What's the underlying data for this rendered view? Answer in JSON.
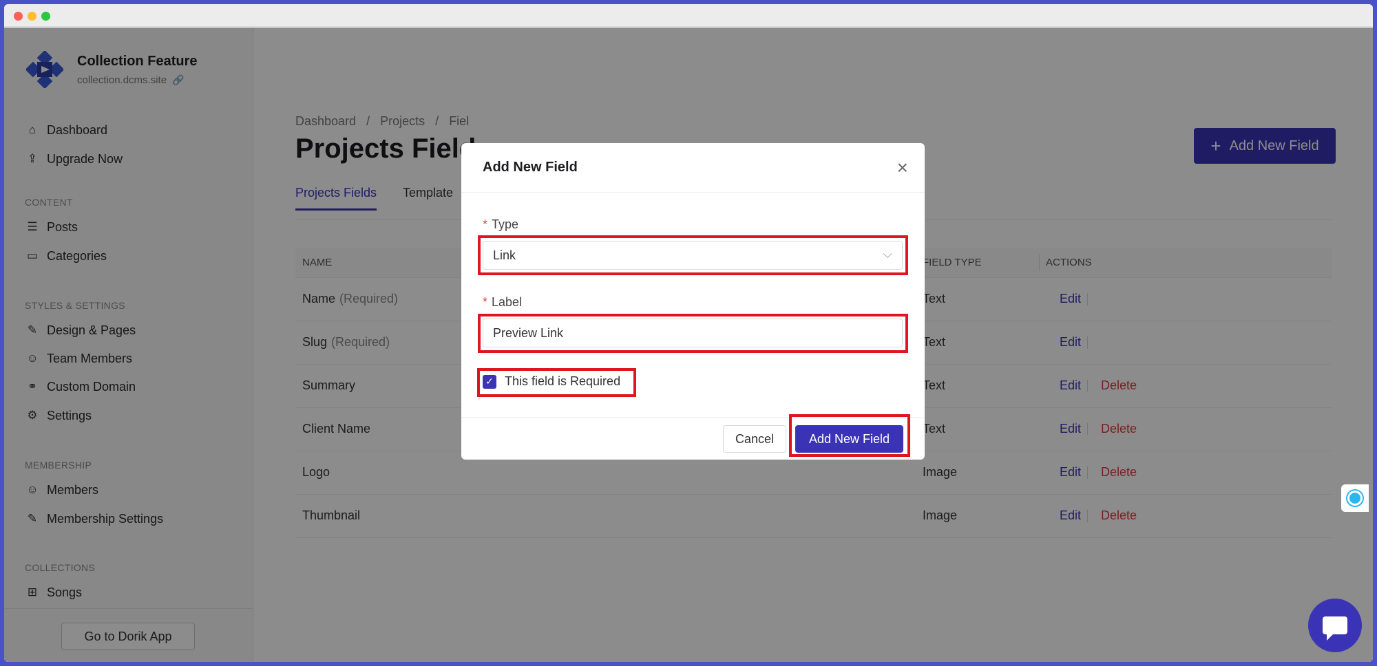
{
  "sidebar": {
    "brand": {
      "name": "Collection Feature",
      "url": "collection.dcms.site"
    },
    "items": {
      "dashboard": "Dashboard",
      "upgrade": "Upgrade Now",
      "posts": "Posts",
      "categories": "Categories",
      "design": "Design & Pages",
      "team": "Team Members",
      "domain": "Custom Domain",
      "settings": "Settings",
      "members": "Members",
      "membership_settings": "Membership Settings",
      "songs": "Songs"
    },
    "sections": {
      "content": "CONTENT",
      "styles": "STYLES & SETTINGS",
      "membership": "MEMBERSHIP",
      "collections": "COLLECTIONS"
    },
    "footer_button": "Go to Dorik App"
  },
  "main": {
    "breadcrumb": [
      "Dashboard",
      "/",
      "Projects",
      "/",
      "Fiel"
    ],
    "title": "Projects Field",
    "add_button": "Add New Field",
    "tabs": [
      "Projects Fields",
      "Template"
    ],
    "table": {
      "headers": {
        "name": "NAME",
        "field_type": "FIELD TYPE",
        "actions": "ACTIONS"
      },
      "rows": [
        {
          "name": "Name",
          "suffix": "(Required)",
          "type": "Text",
          "edit": "Edit",
          "delete": ""
        },
        {
          "name": "Slug",
          "suffix": "(Required)",
          "type": "Text",
          "edit": "Edit",
          "delete": ""
        },
        {
          "name": "Summary",
          "suffix": "",
          "type": "Text",
          "edit": "Edit",
          "delete": "Delete"
        },
        {
          "name": "Client Name",
          "suffix": "",
          "type": "Text",
          "edit": "Edit",
          "delete": "Delete"
        },
        {
          "name": "Logo",
          "suffix": "",
          "type": "Image",
          "edit": "Edit",
          "delete": "Delete"
        },
        {
          "name": "Thumbnail",
          "suffix": "",
          "type": "Image",
          "edit": "Edit",
          "delete": "Delete"
        }
      ]
    }
  },
  "modal": {
    "title": "Add New Field",
    "close_icon": "×",
    "type_label": "Type",
    "type_value": "Link",
    "label_label": "Label",
    "label_value": "Preview Link",
    "required_label": "This field is Required",
    "required_checked": true,
    "cancel": "Cancel",
    "submit": "Add New Field",
    "required_marker": "*"
  },
  "colors": {
    "accent": "#3b33b5",
    "danger": "#d93b3b",
    "highlight": "#e0161e"
  }
}
